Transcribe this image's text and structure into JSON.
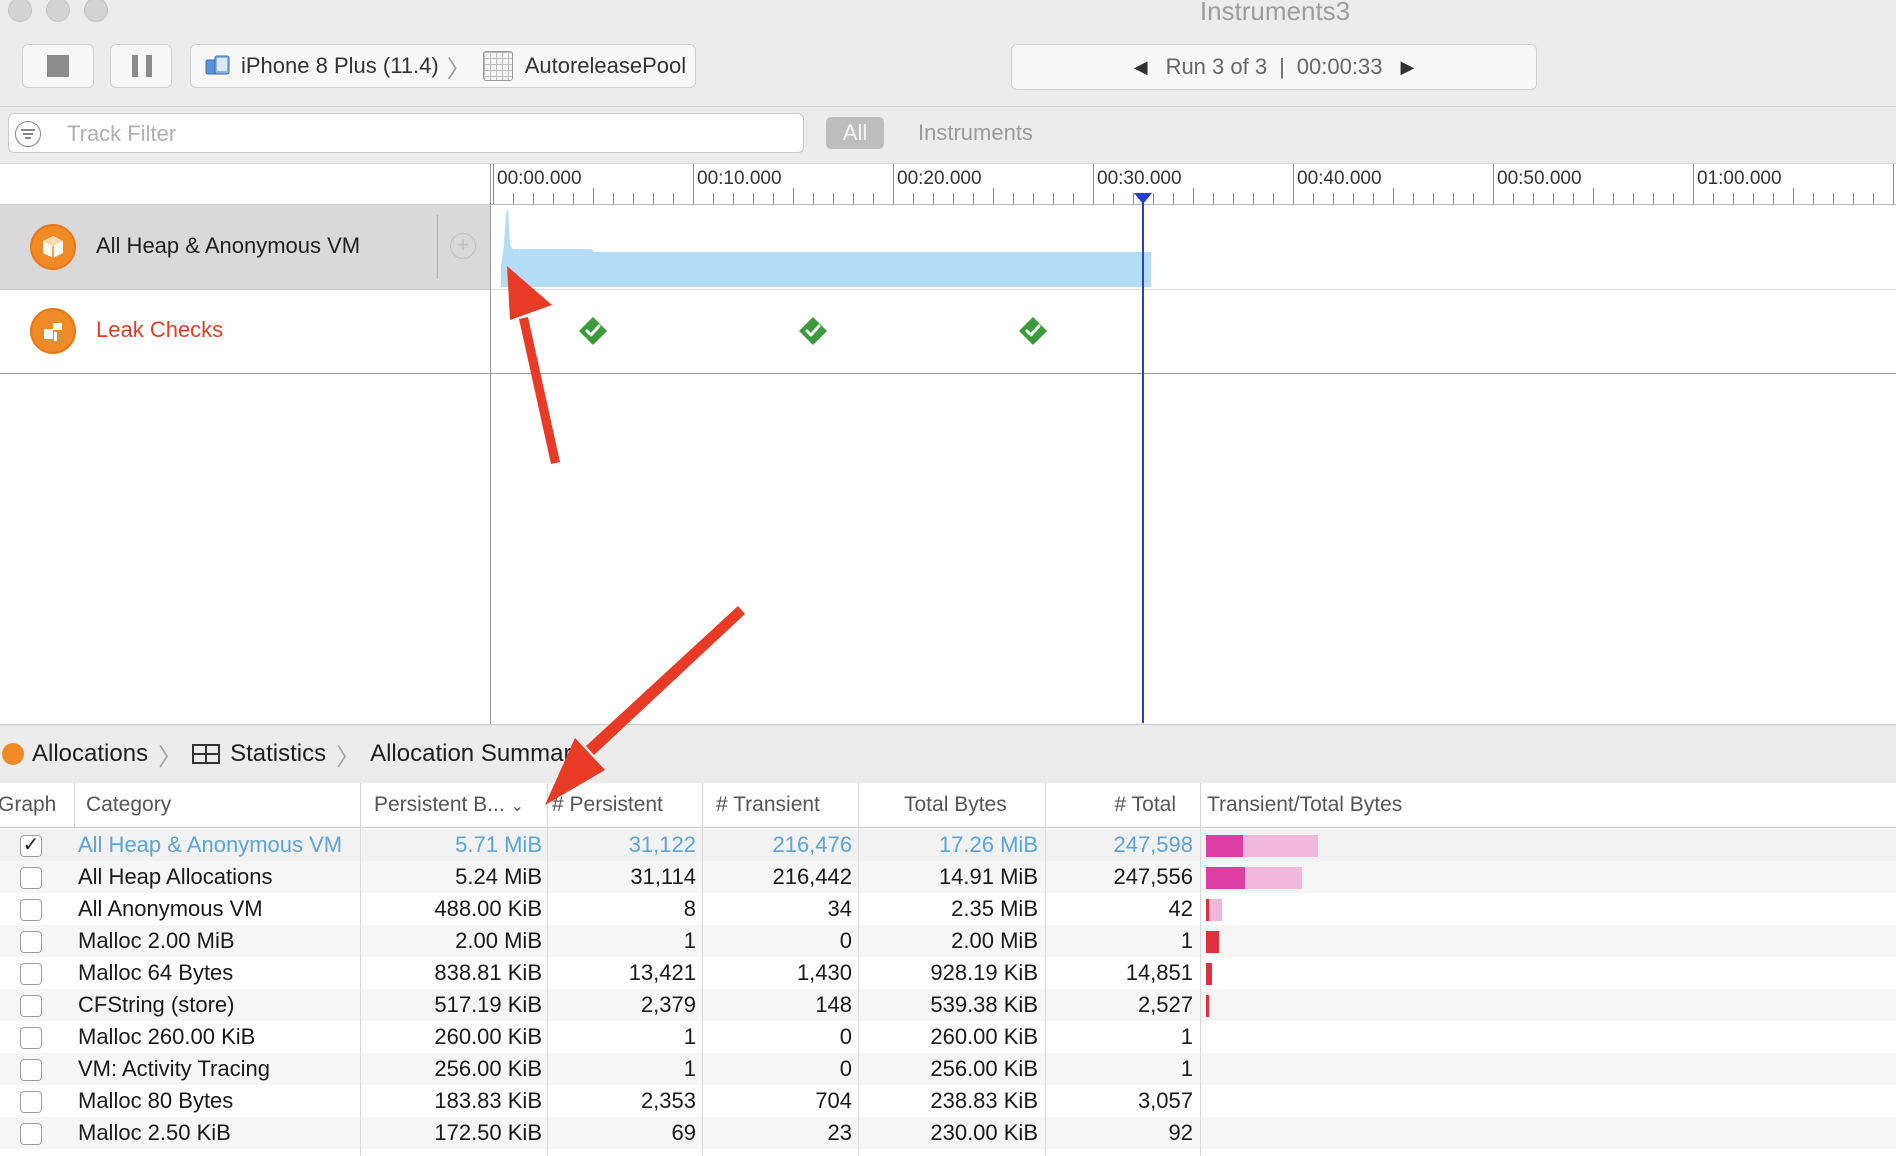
{
  "window": {
    "title": "Instruments3"
  },
  "toolbar": {
    "device": "iPhone 8 Plus (11.4)",
    "template": "AutoreleasePool",
    "run_label": "Run 3 of 3",
    "run_sep": "|",
    "run_time": "00:00:33"
  },
  "filter": {
    "placeholder": "Track Filter",
    "scope_all": "All",
    "scope_instruments": "Instruments"
  },
  "timeline": {
    "ticks": [
      "00:00.000",
      "00:10.000",
      "00:20.000",
      "00:30.000",
      "00:40.000",
      "00:50.000",
      "01:00.000"
    ],
    "playhead_time_s": 32.5,
    "leak_checks_s": [
      5,
      16,
      27
    ]
  },
  "tracks": [
    {
      "name": "All Heap & Anonymous VM",
      "color": "#f08a24"
    },
    {
      "name": "Leak Checks",
      "color": "#e45227"
    }
  ],
  "breadcrumb": [
    "Allocations",
    "Statistics",
    "Allocation Summary"
  ],
  "table": {
    "columns": [
      "Graph",
      "Category",
      "Persistent B...",
      "# Persistent",
      "# Transient",
      "Total Bytes",
      "# Total",
      "Transient/Total Bytes"
    ],
    "rows": [
      {
        "checked": true,
        "category": "All Heap & Anonymous VM",
        "persistent_bytes": "5.71 MiB",
        "persistent": "31,122",
        "transient": "216,476",
        "total_bytes": "17.26 MiB",
        "total": "247,598",
        "bar_persistent": 0.33,
        "bar_total": 1.0
      },
      {
        "checked": false,
        "category": "All Heap Allocations",
        "persistent_bytes": "5.24 MiB",
        "persistent": "31,114",
        "transient": "216,442",
        "total_bytes": "14.91 MiB",
        "total": "247,556",
        "bar_persistent": 0.35,
        "bar_total": 0.86
      },
      {
        "checked": false,
        "category": "All Anonymous VM",
        "persistent_bytes": "488.00 KiB",
        "persistent": "8",
        "transient": "34",
        "total_bytes": "2.35 MiB",
        "total": "42",
        "bar_persistent": 0.02,
        "bar_total": 0.14
      },
      {
        "checked": false,
        "category": "Malloc 2.00 MiB",
        "persistent_bytes": "2.00 MiB",
        "persistent": "1",
        "transient": "0",
        "total_bytes": "2.00 MiB",
        "total": "1",
        "bar_persistent": 0.12,
        "bar_total": 0.12
      },
      {
        "checked": false,
        "category": "Malloc 64 Bytes",
        "persistent_bytes": "838.81 KiB",
        "persistent": "13,421",
        "transient": "1,430",
        "total_bytes": "928.19 KiB",
        "total": "14,851",
        "bar_persistent": 0.05,
        "bar_total": 0.05
      },
      {
        "checked": false,
        "category": "CFString (store)",
        "persistent_bytes": "517.19 KiB",
        "persistent": "2,379",
        "transient": "148",
        "total_bytes": "539.38 KiB",
        "total": "2,527",
        "bar_persistent": 0.03,
        "bar_total": 0.03
      },
      {
        "checked": false,
        "category": "Malloc 260.00 KiB",
        "persistent_bytes": "260.00 KiB",
        "persistent": "1",
        "transient": "0",
        "total_bytes": "260.00 KiB",
        "total": "1",
        "bar_persistent": 0,
        "bar_total": 0
      },
      {
        "checked": false,
        "category": "VM: Activity Tracing",
        "persistent_bytes": "256.00 KiB",
        "persistent": "1",
        "transient": "0",
        "total_bytes": "256.00 KiB",
        "total": "1",
        "bar_persistent": 0,
        "bar_total": 0
      },
      {
        "checked": false,
        "category": "Malloc 80 Bytes",
        "persistent_bytes": "183.83 KiB",
        "persistent": "2,353",
        "transient": "704",
        "total_bytes": "238.83 KiB",
        "total": "3,057",
        "bar_persistent": 0,
        "bar_total": 0
      },
      {
        "checked": false,
        "category": "Malloc 2.50 KiB",
        "persistent_bytes": "172.50 KiB",
        "persistent": "69",
        "transient": "23",
        "total_bytes": "230.00 KiB",
        "total": "92",
        "bar_persistent": 0,
        "bar_total": 0
      }
    ]
  },
  "colors": {
    "selected_row_text": "#5aa5dc",
    "playhead": "#2a3dd3",
    "graph_fill": "#b5dcf6",
    "bar_persistent": "#dd3ea3",
    "bar_transient": "#f1b8dc",
    "bar_small": "#e0303d",
    "annotation": "#e83a25",
    "leak_ok": "#3c9a3c"
  },
  "icons": {
    "filter": "filter-icon",
    "add_track": "plus-circle-icon",
    "leak_ok": "checkmark-diamond-icon",
    "stats": "table-grid-icon"
  }
}
